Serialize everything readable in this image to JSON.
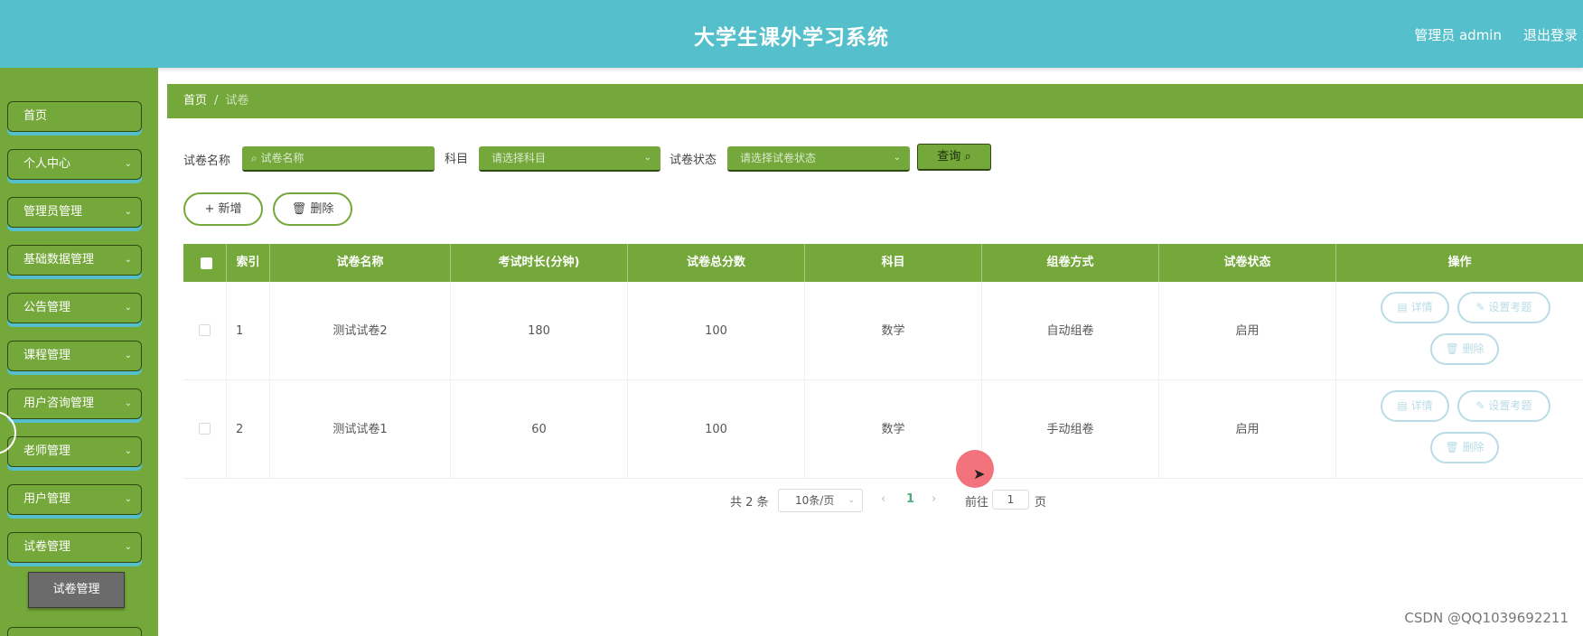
{
  "header": {
    "title": "大学生课外学习系统",
    "user": "管理员 admin",
    "logout": "退出登录"
  },
  "sidebar": {
    "items": [
      {
        "label": "首页",
        "chevron": ""
      },
      {
        "label": "个人中心",
        "chevron": "⌄"
      },
      {
        "label": "管理员管理",
        "chevron": "⌄"
      },
      {
        "label": "基础数据管理",
        "chevron": "⌄"
      },
      {
        "label": "公告管理",
        "chevron": "⌄"
      },
      {
        "label": "课程管理",
        "chevron": "⌄"
      },
      {
        "label": "用户咨询管理",
        "chevron": "⌄"
      },
      {
        "label": "老师管理",
        "chevron": "⌄"
      },
      {
        "label": "用户管理",
        "chevron": "⌄"
      },
      {
        "label": "试卷管理",
        "chevron": "⌄"
      }
    ],
    "submenu": {
      "label": "试卷管理"
    }
  },
  "breadcrumb": {
    "home": "首页",
    "separator": "/",
    "current": "试卷"
  },
  "search": {
    "name_label": "试卷名称",
    "name_placeholder": "试卷名称",
    "subject_label": "科目",
    "subject_placeholder": "请选择科目",
    "status_label": "试卷状态",
    "status_placeholder": "请选择试卷状态",
    "query_label": "查询"
  },
  "actions": {
    "add_label": "新增",
    "delete_label": "删除"
  },
  "table": {
    "columns": [
      "索引",
      "试卷名称",
      "考试时长(分钟)",
      "试卷总分数",
      "科目",
      "组卷方式",
      "试卷状态",
      "操作"
    ],
    "rows": [
      {
        "index": "1",
        "name": "测试试卷2",
        "duration": "180",
        "score": "100",
        "subject": "数学",
        "mode": "自动组卷",
        "status": "启用"
      },
      {
        "index": "2",
        "name": "测试试卷1",
        "duration": "60",
        "score": "100",
        "subject": "数学",
        "mode": "手动组卷",
        "status": "启用"
      }
    ],
    "row_actions": {
      "detail": "详情",
      "set_questions": "设置考题",
      "delete": "删除"
    }
  },
  "pagination": {
    "total": "共 2 条",
    "page_size": "10条/页",
    "current_page": "1",
    "goto_label": "前往",
    "goto_value": "1",
    "page_suffix": "页"
  },
  "watermark": "CSDN @QQ1039692211",
  "colors": {
    "header": "#55bfcc",
    "sidebar": "#75a83a",
    "accent_green": "#75a83a",
    "action_outline": "#b9dce6"
  }
}
